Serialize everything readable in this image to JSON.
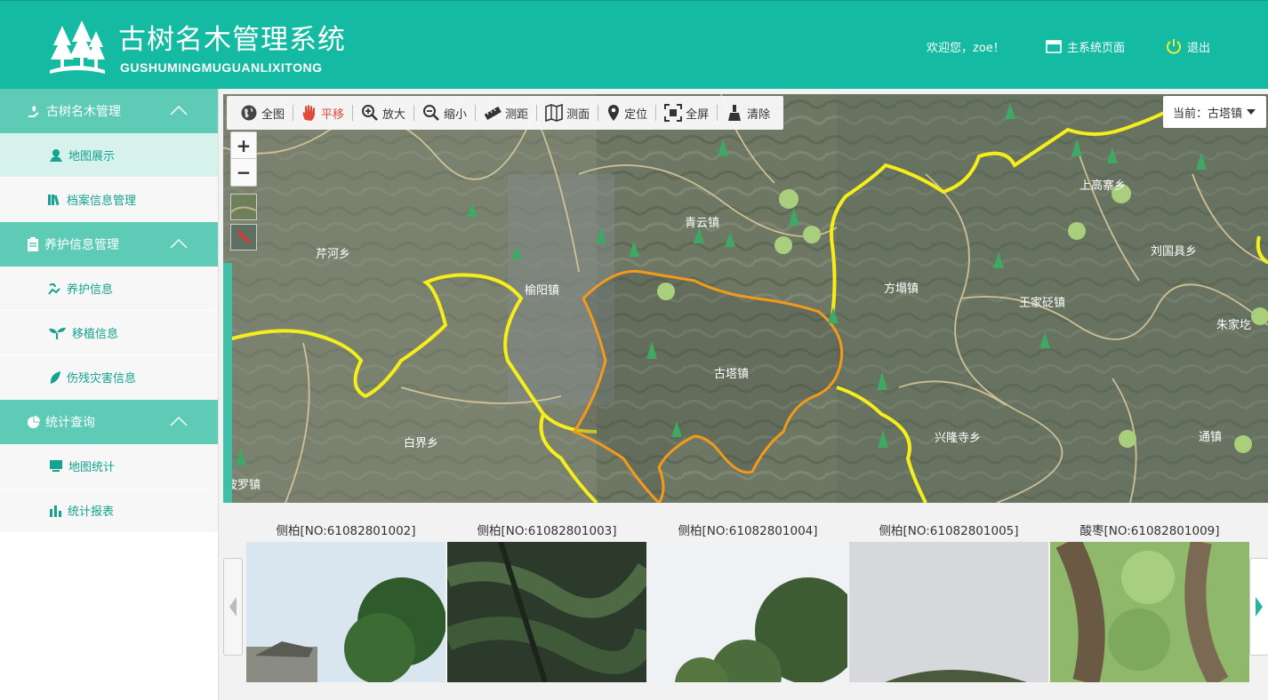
{
  "header": {
    "title_cn": "古树名木管理系统",
    "title_en": "GUSHUMINGMUGUANLIXITONG",
    "welcome": "欢迎您，zoe！",
    "main_page_label": "主系统页面",
    "logout_label": "退出"
  },
  "sidebar": {
    "sections": [
      {
        "label": "古树名木管理",
        "items": [
          "地图展示",
          "档案信息管理"
        ]
      },
      {
        "label": "养护信息管理",
        "items": [
          "养护信息",
          "移植信息",
          "伤残灾害信息"
        ]
      },
      {
        "label": "统计查询",
        "items": [
          "地图统计",
          "统计报表"
        ]
      }
    ]
  },
  "toolbar": {
    "full": "全图",
    "pan": "平移",
    "zoom_in": "放大",
    "zoom_out": "缩小",
    "measure_dist": "测距",
    "measure_area": "测面",
    "locate": "定位",
    "fullscreen": "全屏",
    "clear": "清除"
  },
  "map": {
    "current_label": "当前：古塔镇",
    "zoom_plus": "+",
    "zoom_minus": "−",
    "places": [
      "芹河乡",
      "榆阳镇",
      "青云镇",
      "古塔镇",
      "方塌镇",
      "上高寨乡",
      "刘国具乡",
      "王家砭镇",
      "朱家圪",
      "白界乡",
      "兴隆寺乡",
      "通镇",
      "波罗镇"
    ]
  },
  "gallery": {
    "captions": [
      "侧柏[NO:61082801002]",
      "侧柏[NO:61082801003]",
      "侧柏[NO:61082801004]",
      "侧柏[NO:61082801005]",
      "酸枣[NO:61082801009]"
    ]
  },
  "colors": {
    "brand": "#14bba2",
    "sidebar_section": "#5dcbb6",
    "active_item": "#d7f2ec",
    "boundary_yellow": "#f5ee1a",
    "boundary_orange": "#f39a1a"
  }
}
